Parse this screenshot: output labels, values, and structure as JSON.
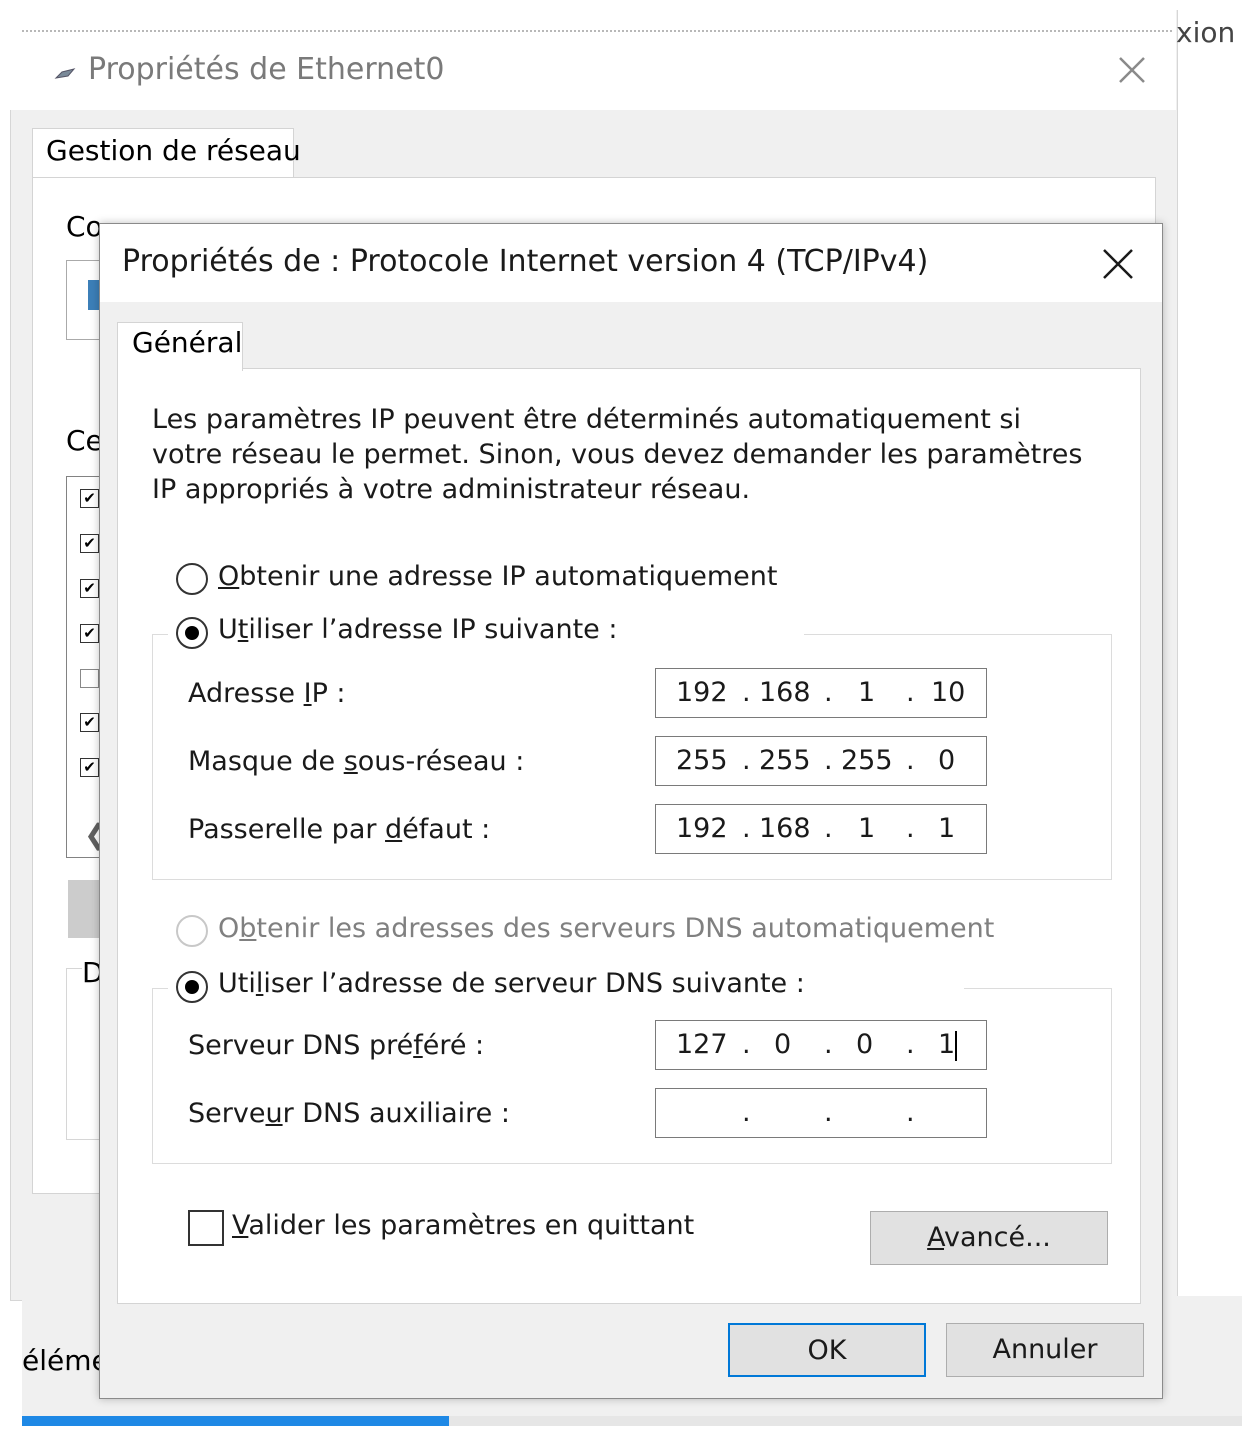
{
  "background_window": {
    "title": "Propriétés de Ethernet0",
    "right_edge_text": "xion",
    "tab": "Gestion de réseau",
    "partial_label_1": "Co",
    "partial_label_2": "Ce",
    "partial_label_3": "D",
    "bottom_partial_text": "éléme",
    "list_checkboxes": [
      "✔",
      "✔",
      "✔",
      "✔",
      "",
      "✔",
      "✔"
    ],
    "scroll_arrow": "❮",
    "progress_fraction": 0.35,
    "progress_color": "#1e88e5"
  },
  "dialog": {
    "title": "Propriétés de : Protocole Internet version 4 (TCP/IPv4)",
    "tab": "Général",
    "description": "Les paramètres IP peuvent être déterminés automatiquement si votre réseau le permet. Sinon, vous devez demander les paramètres IP appropriés à votre administrateur réseau.",
    "ip_mode": {
      "auto": {
        "pre": "",
        "u": "O",
        "post": "btenir une adresse IP automatiquement",
        "selected": false
      },
      "manual": {
        "pre": "U",
        "u": "t",
        "post": "iliser l’adresse IP suivante :",
        "selected": true
      }
    },
    "ip_fields": {
      "address": {
        "pre": "Adresse ",
        "u": "I",
        "post": "P :",
        "octets": [
          "192",
          "168",
          "1",
          "10"
        ]
      },
      "mask": {
        "pre": "Masque de ",
        "u": "s",
        "post": "ous-réseau :",
        "octets": [
          "255",
          "255",
          "255",
          "0"
        ]
      },
      "gateway": {
        "pre": "Passerelle par ",
        "u": "d",
        "post": "éfaut :",
        "octets": [
          "192",
          "168",
          "1",
          "1"
        ]
      }
    },
    "dns_mode": {
      "auto": {
        "pre": "O",
        "u": "b",
        "post": "tenir les adresses des serveurs DNS automatiquement",
        "selected": false,
        "disabled": true
      },
      "manual": {
        "pre": "Uti",
        "u": "l",
        "post": "iser l’adresse de serveur DNS suivante :",
        "selected": true
      }
    },
    "dns_fields": {
      "preferred": {
        "pre": "Serveur DNS pré",
        "u": "f",
        "post": "éré :",
        "octets": [
          "127",
          "0",
          "0",
          "1"
        ]
      },
      "alternate": {
        "pre": "Serve",
        "u": "u",
        "post": "r DNS auxiliaire :",
        "octets": [
          "",
          "",
          "",
          ""
        ]
      }
    },
    "ip_dot": ".",
    "validate_on_exit": {
      "u": "V",
      "post": "alider les paramètres en quittant",
      "checked": false
    },
    "advanced_button": {
      "u": "A",
      "post": "vancé..."
    },
    "ok_button": "OK",
    "cancel_button": "Annuler"
  },
  "colors": {
    "accent": "#0078d7",
    "dialog_bg": "#f0f0f0",
    "panel_bg": "#ffffff"
  }
}
